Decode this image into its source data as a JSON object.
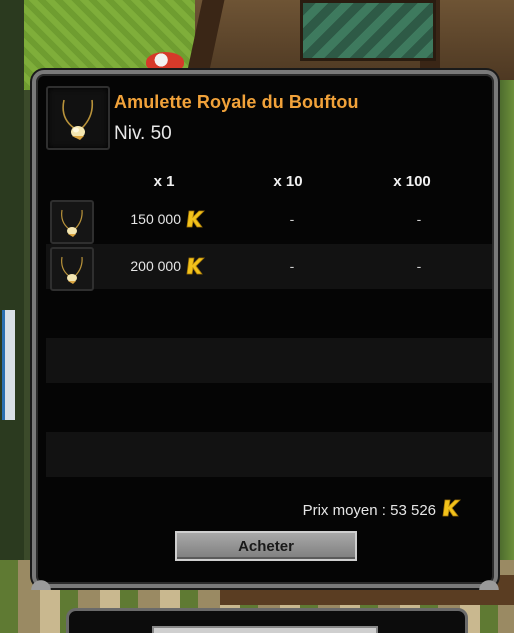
{
  "item": {
    "name": "Amulette Royale du Bouftou",
    "level": "Niv. 50"
  },
  "columns": [
    "x 1",
    "x 10",
    "x 100"
  ],
  "rows": [
    {
      "x1": "150 000",
      "x10": "-",
      "x100": "-"
    },
    {
      "x1": "200 000",
      "x10": "-",
      "x100": "-"
    }
  ],
  "average": {
    "text": "Prix moyen : 53 526"
  },
  "buy_button": "Acheter",
  "colors": {
    "item_name": "#f1a23a",
    "kama_gold": "#f2c21b"
  },
  "icons": {
    "currency": "kama-icon",
    "item": "amulet-icon"
  }
}
